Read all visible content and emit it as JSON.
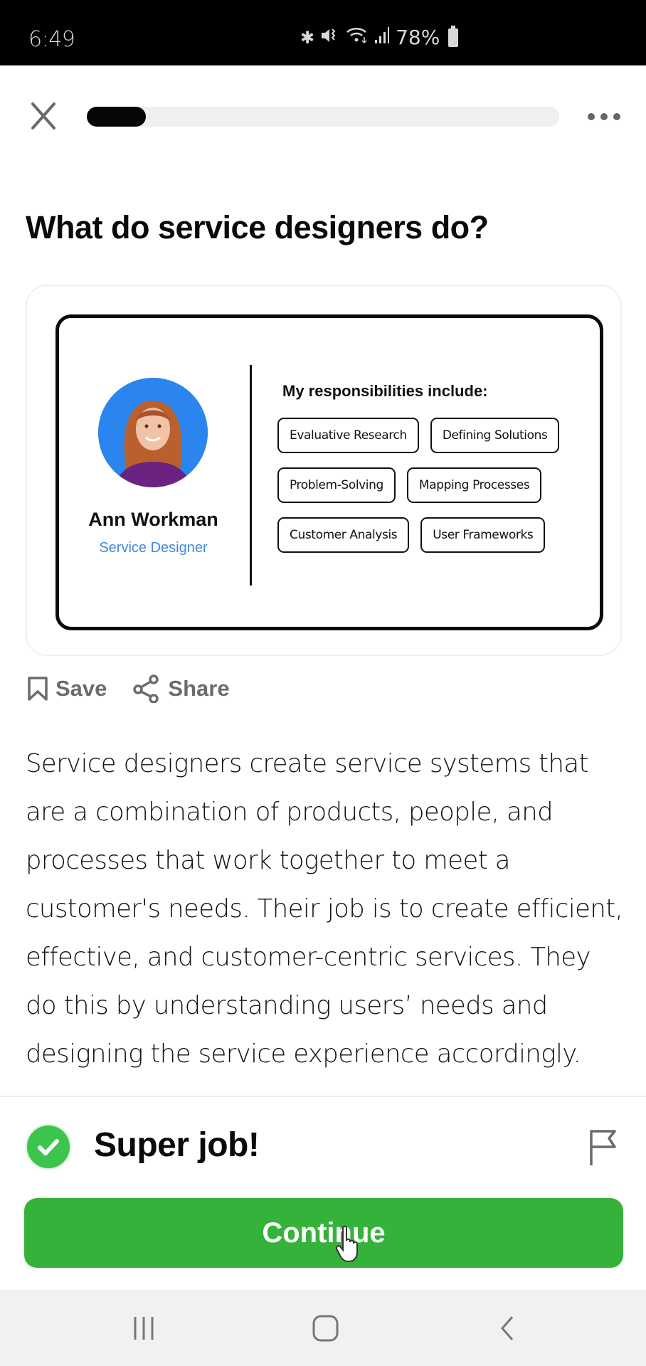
{
  "status_bar": {
    "time": "6:49",
    "icons": [
      "bluetooth-icon",
      "mute-icon",
      "wifi-icon",
      "signal-icon"
    ],
    "battery_percent": "78%"
  },
  "lesson_header": {
    "close_icon": "close-icon",
    "progress_fraction": 0.125,
    "more_icon": "more-horizontal-icon"
  },
  "page": {
    "title": "What do service designers do?"
  },
  "illustration": {
    "profile": {
      "name": "Ann Workman",
      "role": "Service Designer"
    },
    "responsibilities_title": "My responsibilities include:",
    "responsibilities": [
      [
        "Evaluative Research",
        "Defining Solutions"
      ],
      [
        "Problem-Solving",
        "Mapping Processes"
      ],
      [
        "Customer Analysis",
        "User Frameworks"
      ]
    ]
  },
  "actions": {
    "save_label": "Save",
    "share_label": "Share"
  },
  "body": {
    "paragraph": "Service designers create service systems that are a combination of products, people, and processes that work together to meet a customer's needs. Their job is to create efficient, effective, and customer-centric services. They do this by understanding users’ needs and designing the service experience accordingly."
  },
  "feedback": {
    "title": "Super job!",
    "continue_label": "Continue",
    "accent_color": "#35b23a",
    "check_color": "#3cc44c"
  },
  "colors": {
    "role_text": "#3a8de0",
    "avatar_bg": "#2a86ee",
    "action_text": "#6b6b6b"
  }
}
